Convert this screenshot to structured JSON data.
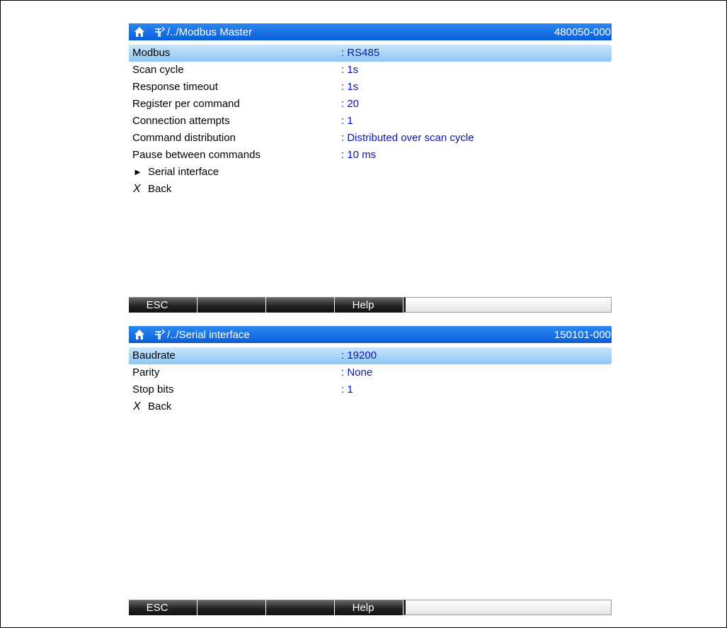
{
  "top_screen": {
    "title_path": "/../Modbus Master",
    "title_code": "480050-000",
    "params": [
      {
        "label": "Modbus",
        "value": ": RS485"
      },
      {
        "label": "Scan cycle",
        "value": ": 1s"
      },
      {
        "label": "Response timeout",
        "value": ": 1s"
      },
      {
        "label": "Register per command",
        "value": ": 20"
      },
      {
        "label": "Connection attempts",
        "value": ": 1"
      },
      {
        "label": "Command distribution",
        "value": ": Distributed over scan cycle"
      },
      {
        "label": "Pause between commands",
        "value": ": 10 ms"
      }
    ],
    "submenu_label": "Serial interface",
    "back_label": "Back",
    "softkeys": [
      "ESC",
      "",
      "",
      "Help"
    ]
  },
  "bottom_screen": {
    "title_path": "/../Serial interface",
    "title_code": "150101-000",
    "params": [
      {
        "label": "Baudrate",
        "value": ": 19200"
      },
      {
        "label": "Parity",
        "value": ": None"
      },
      {
        "label": "Stop bits",
        "value": ": 1"
      }
    ],
    "back_label": "Back",
    "softkeys": [
      "ESC",
      "",
      "",
      "Help"
    ]
  },
  "icons": {
    "home": "home-icon",
    "tree": "menu-tree-icon",
    "submenu": "triangle-right-icon",
    "back": "x-back-icon"
  },
  "colors": {
    "titlebar": "#0a5fd8",
    "selection": "#8cc7f4",
    "value_text": "#0a14a8"
  }
}
